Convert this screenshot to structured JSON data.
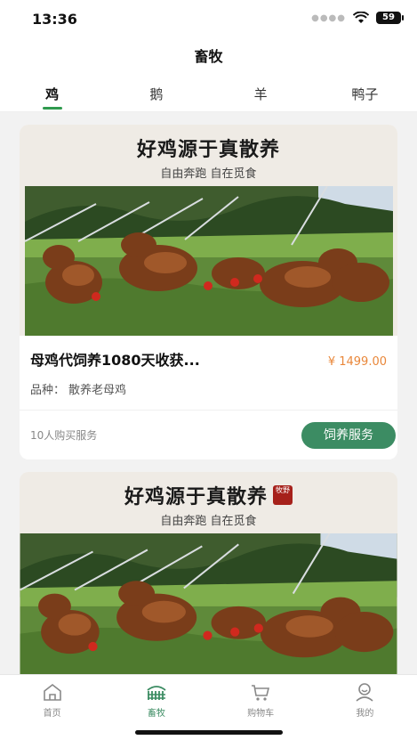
{
  "status": {
    "time": "13:36",
    "battery": "59"
  },
  "header": {
    "title": "畜牧"
  },
  "tabs": [
    {
      "label": "鸡",
      "active": true
    },
    {
      "label": "鹅",
      "active": false
    },
    {
      "label": "羊",
      "active": false
    },
    {
      "label": "鸭子",
      "active": false
    }
  ],
  "cards": [
    {
      "banner_title": "好鸡源于真散养",
      "banner_subtitle": "自由奔跑 自在觅食",
      "product_title": "母鸡代饲养1080天收获...",
      "price": "¥ 1499.00",
      "variety_label": "品种：",
      "variety_value": "散养老母鸡",
      "buyers": "10人购买服务",
      "button_label": "饲养服务"
    },
    {
      "banner_title": "好鸡源于真散养",
      "banner_subtitle": "自由奔跑 自在觅食",
      "seal_text": "牧野"
    }
  ],
  "bottom_nav": [
    {
      "label": "首页",
      "icon": "home-icon",
      "active": false
    },
    {
      "label": "畜牧",
      "icon": "farm-icon",
      "active": true
    },
    {
      "label": "购物车",
      "icon": "cart-icon",
      "active": false
    },
    {
      "label": "我的",
      "icon": "profile-icon",
      "active": false
    }
  ],
  "colors": {
    "accent": "#3c8c63",
    "price": "#e9873a",
    "tab_indicator": "#2f9a4e"
  }
}
